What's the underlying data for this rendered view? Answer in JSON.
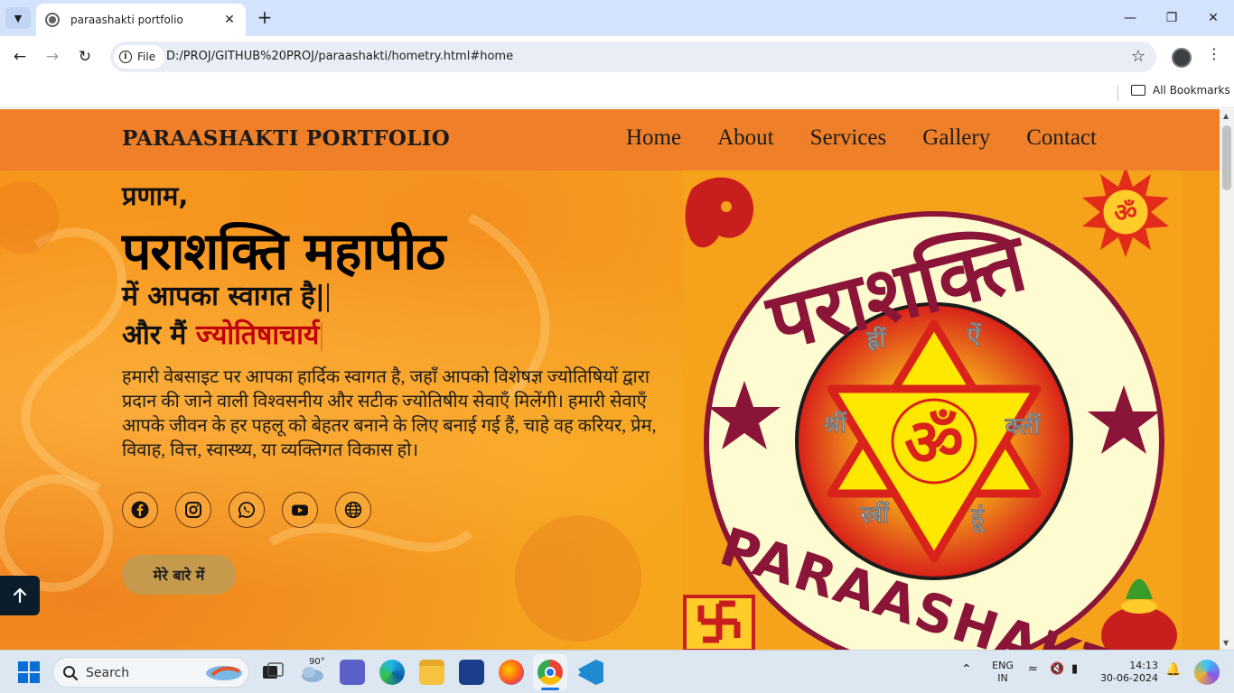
{
  "browser": {
    "tab_title": "paraashakti portfolio",
    "url_chip": "File",
    "url": "D:/PROJ/GITHUB%20PROJ/paraashakti/hometry.html#home",
    "bookmarks_label": "All Bookmarks"
  },
  "site": {
    "brand": "PARAASHAKTI PORTFOLIO",
    "nav": [
      "Home",
      "About",
      "Services",
      "Gallery",
      "Contact"
    ],
    "greeting": "प्रणाम,",
    "title": "पराशक्ति महापीठ",
    "welcome": "में आपका स्वागत है|",
    "role_prefix": "और मैं",
    "role": "ज्योतिषाचार्य",
    "intro": "हमारी वेबसाइट पर आपका हार्दिक स्वागत है, जहाँ आपको विशेषज्ञ ज्योतिषियों द्वारा प्रदान की जाने वाली विश्वसनीय और सटीक ज्योतिषीय सेवाएँ मिलेंगी। हमारी सेवाएँ आपके जीवन के हर पहलू को बेहतर बनाने के लिए बनाई गई हैं, चाहे वह करियर, प्रेम, विवाह, वित्त, स्वास्थ्य, या व्यक्तिगत विकास हो।",
    "about_button": "मेरे बारे में",
    "socials": [
      "facebook-icon",
      "instagram-icon",
      "whatsapp-icon",
      "youtube-icon",
      "globe-icon"
    ]
  },
  "logo": {
    "ring_text": "पराशक्ति",
    "ring_text_bottom": "PARAASHAKTI",
    "center": "ॐ",
    "mantras": [
      "ह्रीं",
      "ऐं",
      "श्रीं",
      "क्लीं",
      "स्त्रीं",
      "हूं"
    ]
  },
  "taskbar": {
    "search": "Search",
    "weather": "90°",
    "lang_top": "ENG",
    "lang_bottom": "IN",
    "time": "14:13",
    "date": "30-06-2024"
  },
  "colors": {
    "nav_bg": "#ef8029",
    "accent_red": "#c0000b",
    "button_bg": "#c69a4c",
    "logo_maroon": "#8b1538"
  }
}
